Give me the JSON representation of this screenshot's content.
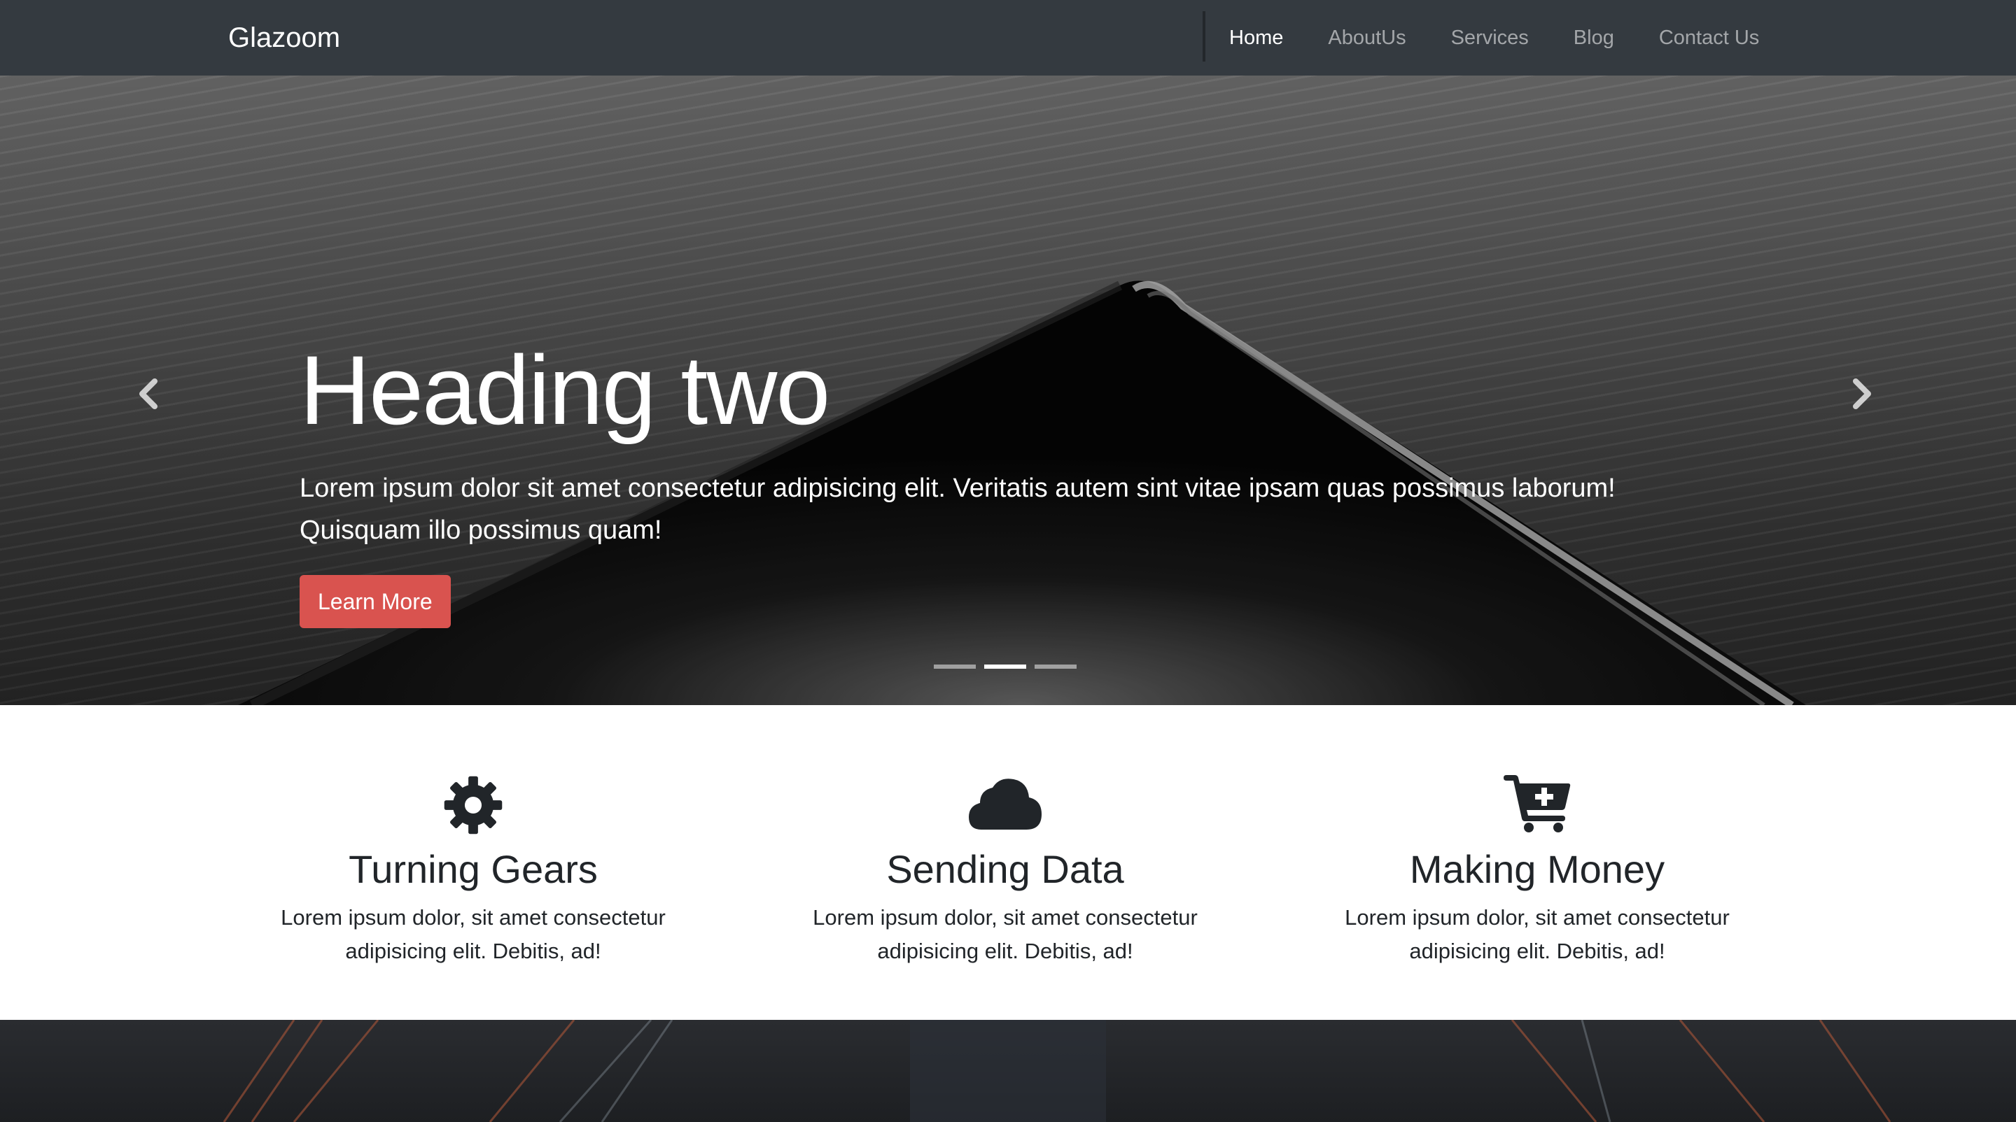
{
  "navbar": {
    "brand": "Glazoom",
    "links": [
      {
        "label": "Home",
        "active": true
      },
      {
        "label": "AboutUs",
        "active": false
      },
      {
        "label": "Services",
        "active": false
      },
      {
        "label": "Blog",
        "active": false
      },
      {
        "label": "Contact Us",
        "active": false
      }
    ]
  },
  "carousel": {
    "heading": "Heading two",
    "text": "Lorem ipsum dolor sit amet consectetur adipisicing elit. Veritatis autem sint vitae ipsam quas possimus laborum! Quisquam illo possimus quam!",
    "button_label": "Learn More",
    "slide_count": 3,
    "active_slide": 2,
    "prev_icon": "chevron-left-icon",
    "next_icon": "chevron-right-icon"
  },
  "features": [
    {
      "icon": "gear-icon",
      "title": "Turning Gears",
      "text": "Lorem ipsum dolor, sit amet consectetur adipisicing elit. Debitis, ad!"
    },
    {
      "icon": "cloud-icon",
      "title": "Sending Data",
      "text": "Lorem ipsum dolor, sit amet consectetur adipisicing elit. Debitis, ad!"
    },
    {
      "icon": "cart-plus-icon",
      "title": "Making Money",
      "text": "Lorem ipsum dolor, sit amet consectetur adipisicing elit. Debitis, ad!"
    }
  ],
  "colors": {
    "navbar_bg": "#343a40",
    "button_danger": "#d9534f",
    "text_dark": "#212529"
  }
}
